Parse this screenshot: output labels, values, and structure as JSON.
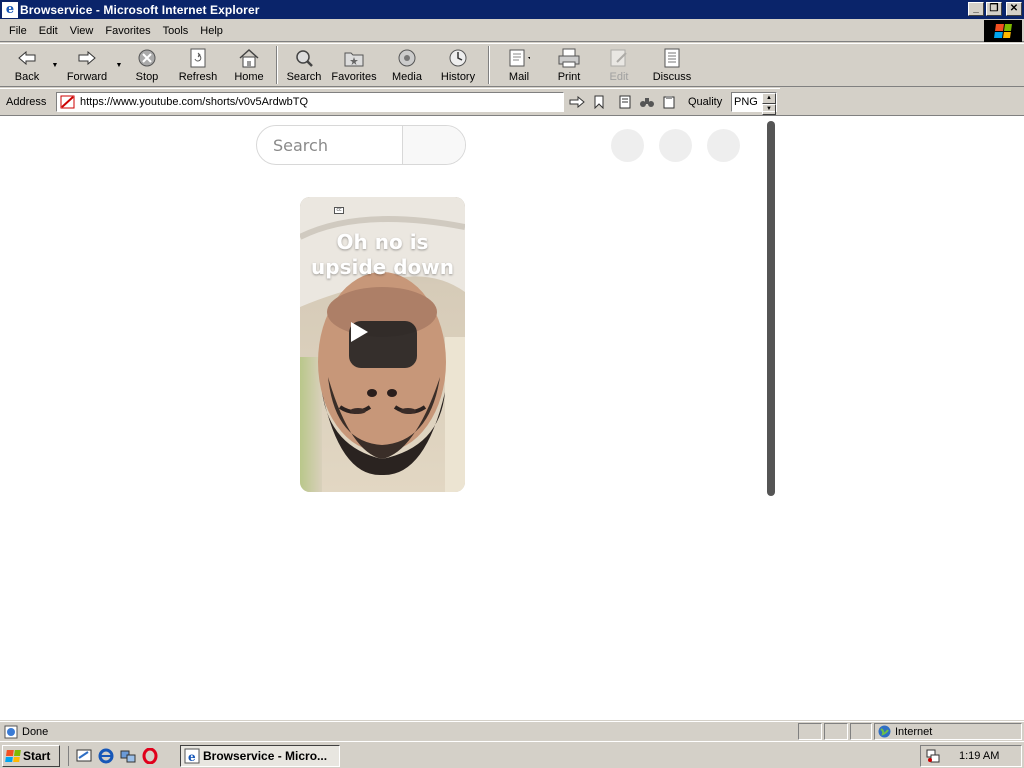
{
  "window": {
    "title": "Browservice - Microsoft Internet Explorer",
    "controls": {
      "minimize": "_",
      "restore": "❐",
      "close": "✕"
    }
  },
  "menu": [
    "File",
    "Edit",
    "View",
    "Favorites",
    "Tools",
    "Help"
  ],
  "toolbar": {
    "back": "Back",
    "forward": "Forward",
    "stop": "Stop",
    "refresh": "Refresh",
    "home": "Home",
    "search": "Search",
    "favorites": "Favorites",
    "media": "Media",
    "history": "History",
    "mail": "Mail",
    "print": "Print",
    "edit": "Edit",
    "discuss": "Discuss"
  },
  "address": {
    "label": "Address",
    "url": "https://www.youtube.com/shorts/v0v5ArdwbTQ",
    "quality_label": "Quality",
    "quality_value": "PNG"
  },
  "page": {
    "search_placeholder": "Search",
    "short_title": "Oh no is upside down",
    "cc": "cc"
  },
  "status": {
    "text": "Done",
    "zone": "Internet"
  },
  "taskbar": {
    "start": "Start",
    "task": "Browservice - Micro...",
    "clock": "1:19 AM"
  },
  "colors": {
    "titlebar": "#0a246a",
    "chrome": "#d4d0c8",
    "scrollbar_thumb": "#555555",
    "play_button": "#212121"
  }
}
